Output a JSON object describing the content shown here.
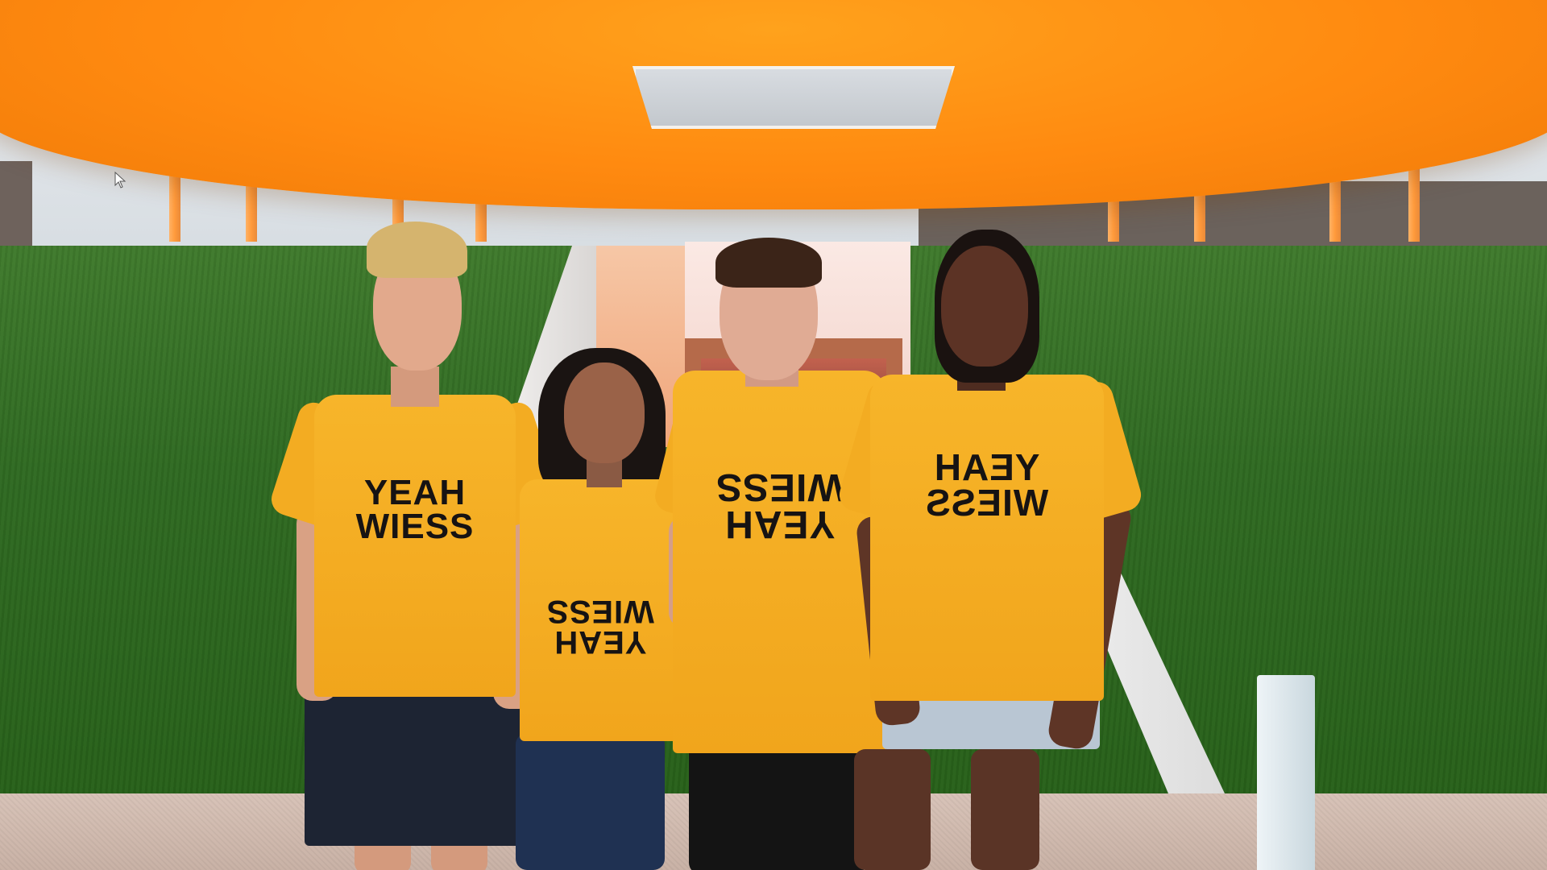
{
  "scene": {
    "colors": {
      "canopy": "#ff8a10",
      "lawn": "#2f6a22",
      "shirt": "#f4ac22",
      "print": "#161313"
    }
  },
  "shirts": [
    {
      "line1": "YEAH",
      "line2": "WIESS",
      "orientation": "normal"
    },
    {
      "line1": "WIESS",
      "line2": "YEAH",
      "orientation": "upside-down"
    },
    {
      "line1": "WIESS",
      "line2": "YEAH",
      "orientation": "upside-down"
    },
    {
      "line1": "YEAH",
      "line2": "WIESS",
      "orientation": "mirrored"
    }
  ]
}
